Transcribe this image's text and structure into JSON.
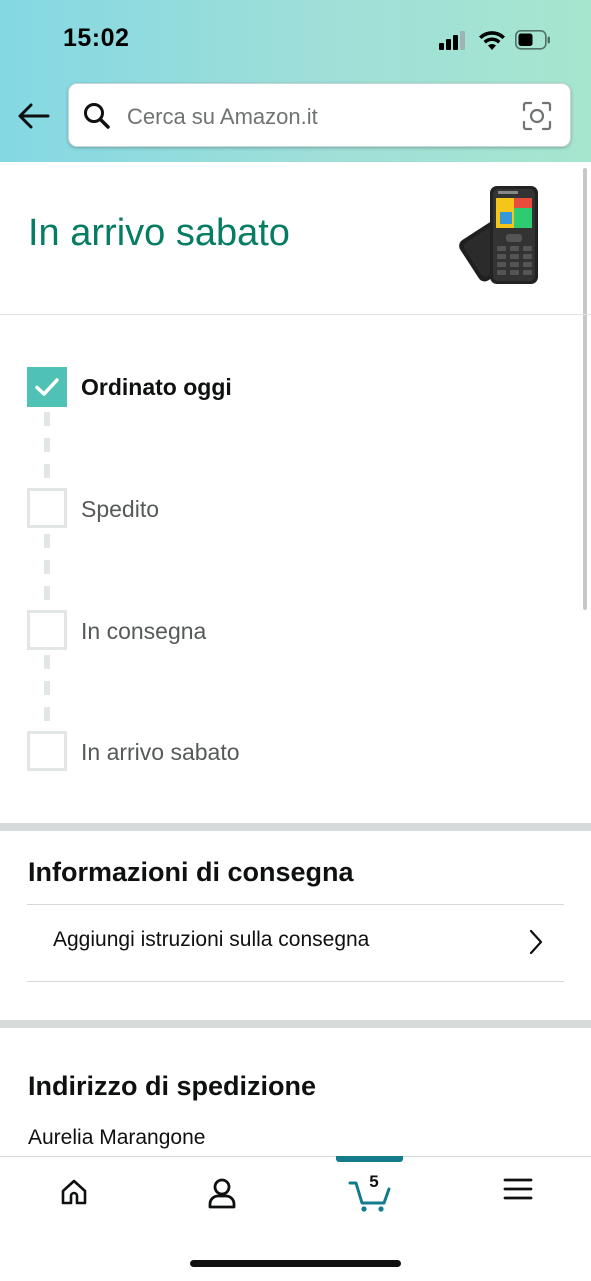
{
  "status_bar": {
    "time": "15:02",
    "icons": [
      "cellular-signal-icon",
      "wifi-icon",
      "battery-icon"
    ]
  },
  "header": {
    "back_icon": "arrow-left-icon",
    "search": {
      "placeholder": "Cerca su Amazon.it",
      "value": "",
      "left_icon": "search-icon",
      "right_icon": "camera-scan-icon"
    }
  },
  "delivery": {
    "title": "In arrivo sabato",
    "product_image": "mobile-phone-product-image",
    "accent_color": "#067d62",
    "steps": [
      {
        "label": "Ordinato oggi",
        "done": true
      },
      {
        "label": "Spedito",
        "done": false
      },
      {
        "label": "In consegna",
        "done": false
      },
      {
        "label": "In arrivo sabato",
        "done": false
      }
    ],
    "check_color": "#4fc1b5"
  },
  "delivery_info": {
    "title": "Informazioni di consegna",
    "add_instructions": "Aggiungi istruzioni sulla consegna"
  },
  "shipping_address": {
    "title": "Indirizzo di spedizione",
    "name": "Aurelia Marangone"
  },
  "tab_bar": {
    "tabs": [
      {
        "name": "home",
        "icon": "home-icon"
      },
      {
        "name": "account",
        "icon": "user-icon"
      },
      {
        "name": "cart",
        "icon": "cart-icon"
      },
      {
        "name": "menu",
        "icon": "hamburger-menu-icon"
      }
    ],
    "cart_count": "5",
    "active_tab": "cart",
    "indicator_color": "#137b8b"
  }
}
